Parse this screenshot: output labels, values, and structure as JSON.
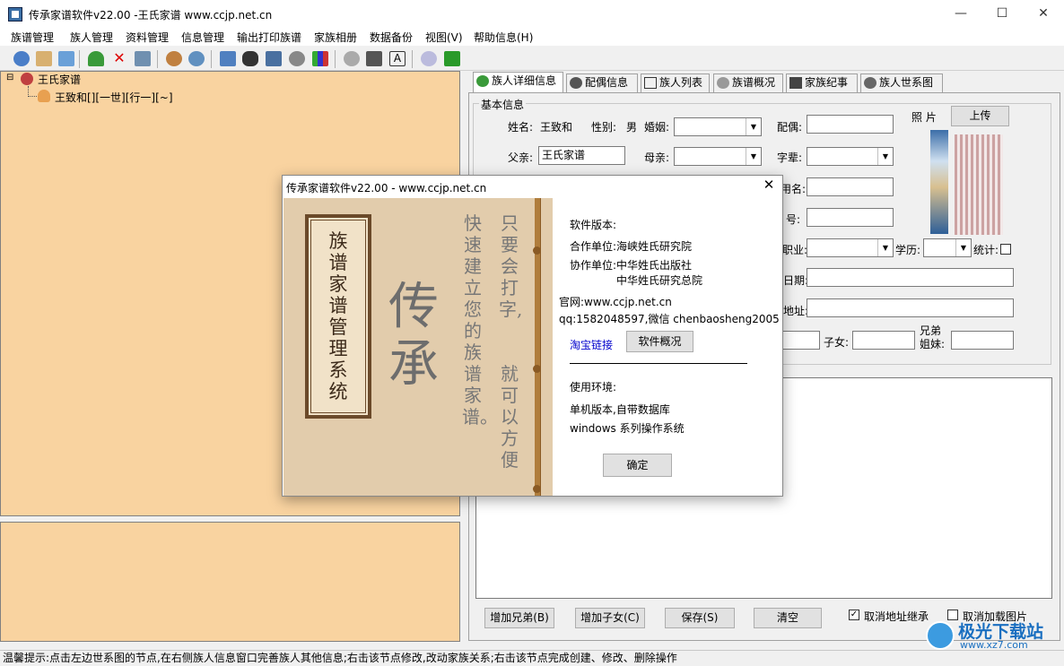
{
  "window": {
    "title": "传承家谱软件v22.00 -王氏家谱 www.ccjp.net.cn",
    "min": "—",
    "max": "☐",
    "close": "✕"
  },
  "menu": [
    "族谱管理",
    "族人管理",
    "资料管理",
    "信息管理",
    "输出打印族谱",
    "家族相册",
    "数据备份",
    "视图(V)",
    "帮助信息(H)"
  ],
  "tree": {
    "root_toggle": "⊟",
    "root": "王氏家谱",
    "child": "王致和[][一世][行一][~]"
  },
  "tabs": [
    "族人详细信息",
    "配偶信息",
    "族人列表",
    "族谱概况",
    "家族纪事",
    "族人世系图"
  ],
  "form": {
    "legend": "基本信息",
    "name_label": "姓名:",
    "name_value": "王致和",
    "gender_label": "性别:",
    "gender_value": "男",
    "marriage_label": "婚姻:",
    "spouse_label": "配偶:",
    "photo_label": "照  片",
    "upload_btn": "上传",
    "father_label": "父亲:",
    "father_value": "王氏家谱",
    "mother_label": "母亲:",
    "generation_label": "字辈:",
    "alias_label": "用名:",
    "hao_label": "号:",
    "job_label": "职业:",
    "education_label": "学历:",
    "stat_label": "统计:",
    "date_label": "日期:",
    "address_label": "地址:",
    "children_label": "子女:",
    "siblings_label": "兄弟\n姐妹:"
  },
  "buttons": {
    "add_sibling": "增加兄弟(B)",
    "add_child": "增加子女(C)",
    "save": "保存(S)",
    "clear": "清空"
  },
  "checkboxes": {
    "cancel_addr": "取消地址继承",
    "cancel_img": "取消加载图片"
  },
  "status": "温馨提示:点击左边世系图的节点,在右侧族人信息窗口完善族人其他信息;右击该节点修改,改动家族关系;右击该节点完成创建、修改、删除操作",
  "dialog": {
    "title": "传承家谱软件v22.00 - www.ccjp.net.cn",
    "close": "✕",
    "art_title": "族谱家谱管理系统",
    "art_big": "传承",
    "art_col1": "只要会打字,",
    "art_col2": "就可以方便",
    "art_col3": "快速建立您的族谱家谱。",
    "version_label": "软件版本:",
    "partner": "合作单位:海峡姓氏研究院",
    "assist1": "协作单位:中华姓氏出版社",
    "assist2": "中华姓氏研究总院",
    "site": "官网:www.ccjp.net.cn",
    "qq": "qq:1582048597,微信 chenbaosheng2005",
    "taobao": "淘宝链接",
    "overview_btn": "软件概况",
    "env_label": "使用环境:",
    "env1": "单机版本,自带数据库",
    "env2": "windows 系列操作系统",
    "ok_btn": "确定"
  },
  "watermark": {
    "text": "极光下载站",
    "url": "www.xz7.com"
  },
  "colors": {
    "pane": "#f9d3a0",
    "link": "#0000cc",
    "accent": "#3a6ea5"
  }
}
